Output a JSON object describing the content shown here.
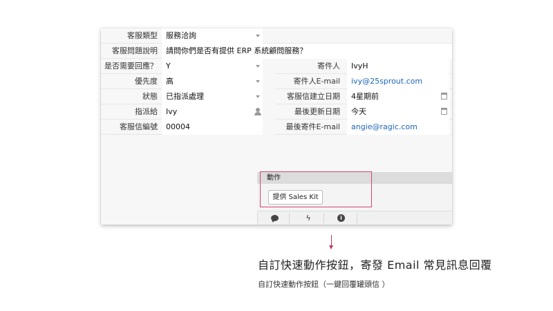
{
  "form": {
    "fields_full": [
      {
        "label": "客服類型",
        "value": "服務洽詢",
        "control": "dropdown"
      },
      {
        "label": "客服問題說明",
        "value": "請問你們是否有提供 ERP 系統顧問服務？",
        "control": "text"
      }
    ],
    "fields_left": [
      {
        "label": "是否需要回應？",
        "value": "Y",
        "control": "dropdown"
      },
      {
        "label": "優先度",
        "value": "高",
        "control": "dropdown"
      },
      {
        "label": "狀態",
        "value": "已指派處理",
        "control": "dropdown"
      },
      {
        "label": "指派給",
        "value": "Ivy",
        "control": "user"
      },
      {
        "label": "客服信編號",
        "value": "00004",
        "control": "text"
      }
    ],
    "fields_right": [
      {
        "label": "寄件人",
        "value": "IvyH",
        "control": "text"
      },
      {
        "label": "寄件人E-mail",
        "value": "ivy@25sprout.com",
        "control": "link"
      },
      {
        "label": "客服信建立日期",
        "value": "4星期前",
        "control": "date"
      },
      {
        "label": "最後更新日期",
        "value": "今天",
        "control": "date"
      },
      {
        "label": "最後寄件E-mail",
        "value": "angie@ragic.com",
        "control": "link"
      }
    ]
  },
  "actions": {
    "header": "動作",
    "button_label": "提供 Sales Kit"
  },
  "toolbar": {
    "icons": [
      "comment-icon",
      "lightning-icon",
      "info-icon"
    ]
  },
  "caption": {
    "title": "自訂快速動作按鈕，寄發 Email 常見訊息回覆",
    "subtitle": "自訂快速動作按鈕（一鍵回覆罐頭信 ）"
  },
  "colors": {
    "highlight": "#d6426f",
    "link": "#1a66b8",
    "arrow": "#c23b5f"
  }
}
